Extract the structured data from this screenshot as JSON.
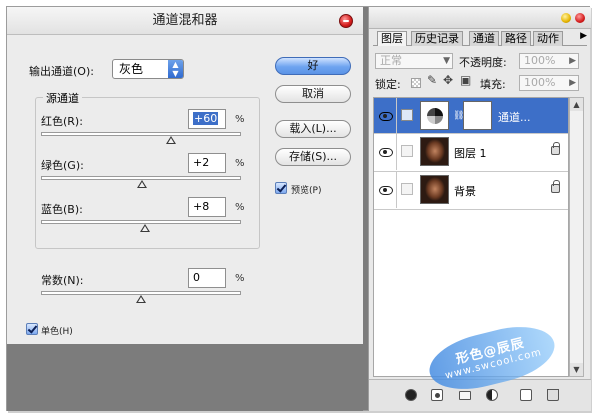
{
  "dialog": {
    "title": "通道混和器",
    "output_channel_label": "输出通道(O):",
    "output_channel_value": "灰色",
    "source_group_label": "源通道",
    "red_label": "红色(R):",
    "red_value": "+60",
    "red_level": 60,
    "green_label": "绿色(G):",
    "green_value": "+2",
    "green_level": 2,
    "blue_label": "蓝色(B):",
    "blue_value": "+8",
    "blue_level": 8,
    "constant_label": "常数(N):",
    "constant_value": "0",
    "constant_level": 0,
    "percent": "%",
    "ok_label": "好",
    "cancel_label": "取消",
    "load_label": "载入(L)...",
    "save_label": "存储(S)...",
    "preview_label": "预览(P)",
    "monochrome_label": "单色(H)"
  },
  "layers_panel": {
    "tabs": [
      "图层",
      "历史记录",
      "通道",
      "路径",
      "动作"
    ],
    "blend_mode": "正常",
    "opacity_label": "不透明度:",
    "opacity_value": "100%",
    "lock_label": "锁定:",
    "fill_label": "填充:",
    "fill_value": "100%",
    "layers": [
      {
        "name": "通道...",
        "type": "adjustment",
        "selected": true
      },
      {
        "name": "图层 1",
        "type": "photo",
        "selected": false
      },
      {
        "name": "背景",
        "type": "photo",
        "selected": false
      }
    ]
  },
  "watermark": {
    "line1": "形色@辰辰",
    "line2": "www.swcool.com"
  }
}
